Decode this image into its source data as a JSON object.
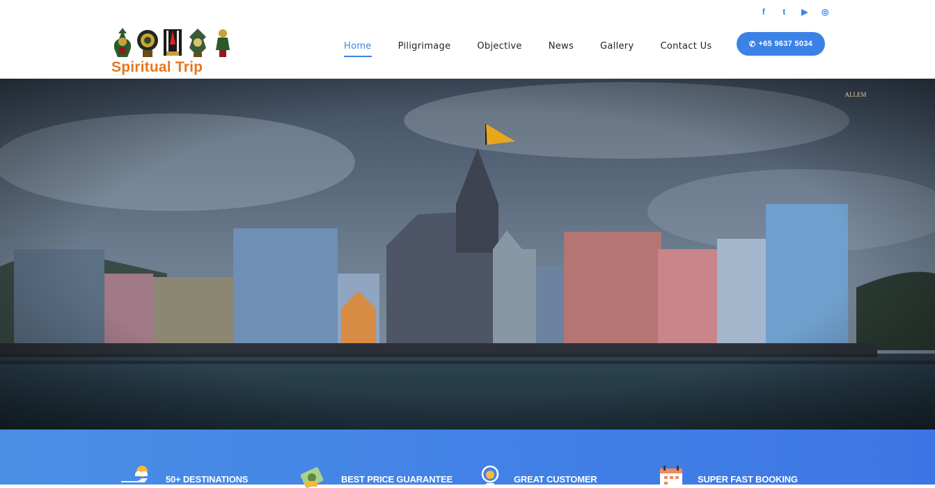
{
  "header": {
    "logo_text": "Spiritual Trip",
    "social": [
      {
        "icon": "facebook-icon",
        "glyph": "f"
      },
      {
        "icon": "twitter-icon",
        "glyph": "t"
      },
      {
        "icon": "youtube-icon",
        "glyph": "▶"
      },
      {
        "icon": "instagram-icon",
        "glyph": "◎"
      }
    ],
    "nav": [
      {
        "label": "Home",
        "active": true
      },
      {
        "label": "Piligrimage"
      },
      {
        "label": "Objective"
      },
      {
        "label": "News"
      },
      {
        "label": "Gallery"
      },
      {
        "label": "Contact Us"
      }
    ],
    "phone_icon": "phone-icon",
    "phone": "+65 9637 5034"
  },
  "hero": {
    "image": "temple-on-river-photo",
    "watermark": "ALLEM"
  },
  "features": [
    {
      "icon": "plane-cloud-icon",
      "label": "50+ DESTINATIONS"
    },
    {
      "icon": "money-icon",
      "label": "BEST PRICE GUARANTEE"
    },
    {
      "icon": "support-icon",
      "label": "GREAT CUSTOMER"
    },
    {
      "icon": "calendar-icon",
      "label": "SUPER FAST BOOKING"
    }
  ],
  "colors": {
    "accent": "#3b82e6",
    "logo_orange": "#e8761c"
  }
}
